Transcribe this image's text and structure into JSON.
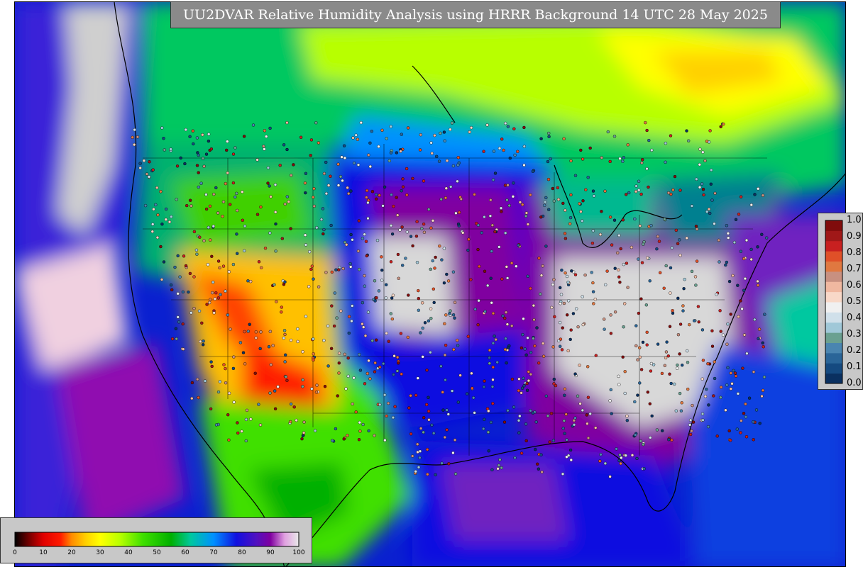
{
  "title": "UU2DVAR Relative Humidity Analysis using HRRR Background 14 UTC 28 May 2025",
  "rh_colorbar": {
    "ticks": [
      "0",
      "10",
      "20",
      "30",
      "40",
      "50",
      "60",
      "70",
      "80",
      "90",
      "100"
    ],
    "stops": [
      {
        "v": 0,
        "c": "#000000"
      },
      {
        "v": 6,
        "c": "#8b0000"
      },
      {
        "v": 10,
        "c": "#e00000"
      },
      {
        "v": 16,
        "c": "#ff1a00"
      },
      {
        "v": 20,
        "c": "#ff8c00"
      },
      {
        "v": 25,
        "c": "#ffd000"
      },
      {
        "v": 30,
        "c": "#ffff00"
      },
      {
        "v": 37,
        "c": "#b8ff00"
      },
      {
        "v": 45,
        "c": "#40e000"
      },
      {
        "v": 55,
        "c": "#00b000"
      },
      {
        "v": 62,
        "c": "#00c8a0"
      },
      {
        "v": 70,
        "c": "#0090ff"
      },
      {
        "v": 78,
        "c": "#1010e0"
      },
      {
        "v": 85,
        "c": "#5010c0"
      },
      {
        "v": 90,
        "c": "#8000a0"
      },
      {
        "v": 95,
        "c": "#e0a0e0"
      },
      {
        "v": 100,
        "c": "#e8e8e8"
      }
    ]
  },
  "obs_colorbar": {
    "ticks": [
      "1.0",
      "0.9",
      "0.8",
      "0.7",
      "0.6",
      "0.5",
      "0.4",
      "0.3",
      "0.2",
      "0.1",
      "0.0"
    ],
    "colors": [
      "#0a3060",
      "#154a80",
      "#2a6598",
      "#4a85b0",
      "#6aa090",
      "#a0c8d8",
      "#d0e0ea",
      "#f0f0f0",
      "#f8d8c8",
      "#f0b8a0",
      "#c89080",
      "#e07840",
      "#e05028",
      "#c82020",
      "#a01818",
      "#800c0c"
    ]
  },
  "colors": {
    "land_west_dry": "#ff2000",
    "land_moist": "#1010e0",
    "land_saturated": "#d8d8d8",
    "ocean": "#0a20d0",
    "north_canada": "#ffff00"
  }
}
